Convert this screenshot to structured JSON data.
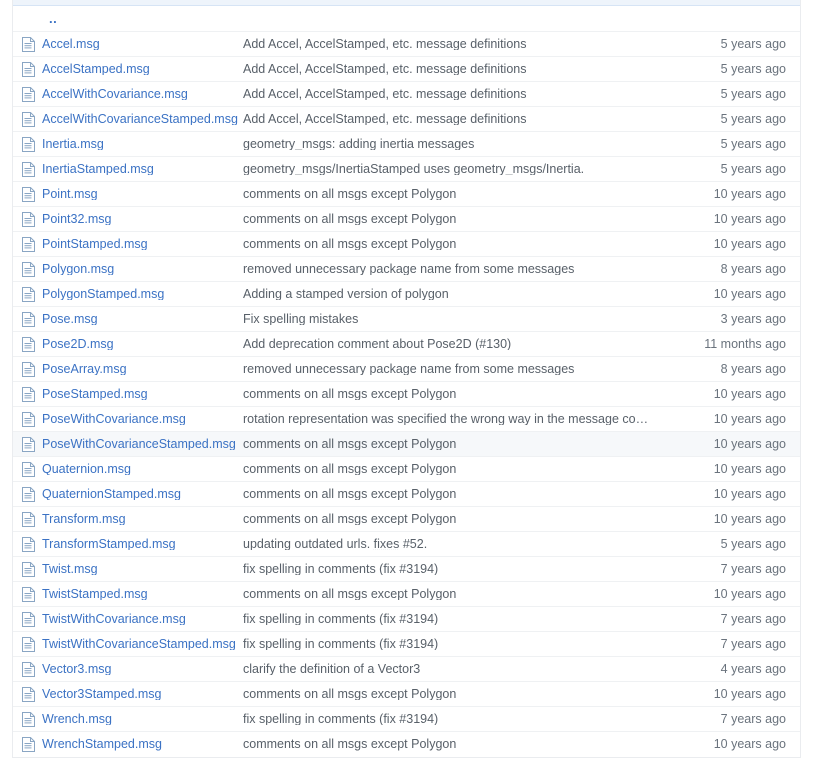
{
  "table": {
    "parent_dir_label": "..",
    "file_icon_name": "file-icon",
    "rows": [
      {
        "name": "Accel.msg",
        "message": "Add Accel, AccelStamped, etc. message definitions",
        "age": "5 years ago",
        "highlight": false
      },
      {
        "name": "AccelStamped.msg",
        "message": "Add Accel, AccelStamped, etc. message definitions",
        "age": "5 years ago",
        "highlight": false
      },
      {
        "name": "AccelWithCovariance.msg",
        "message": "Add Accel, AccelStamped, etc. message definitions",
        "age": "5 years ago",
        "highlight": false
      },
      {
        "name": "AccelWithCovarianceStamped.msg",
        "message": "Add Accel, AccelStamped, etc. message definitions",
        "age": "5 years ago",
        "highlight": false
      },
      {
        "name": "Inertia.msg",
        "message": "geometry_msgs: adding inertia messages",
        "age": "5 years ago",
        "highlight": false
      },
      {
        "name": "InertiaStamped.msg",
        "message": "geometry_msgs/InertiaStamped uses geometry_msgs/Inertia.",
        "age": "5 years ago",
        "highlight": false
      },
      {
        "name": "Point.msg",
        "message": "comments on all msgs except Polygon",
        "age": "10 years ago",
        "highlight": false
      },
      {
        "name": "Point32.msg",
        "message": "comments on all msgs except Polygon",
        "age": "10 years ago",
        "highlight": false
      },
      {
        "name": "PointStamped.msg",
        "message": "comments on all msgs except Polygon",
        "age": "10 years ago",
        "highlight": false
      },
      {
        "name": "Polygon.msg",
        "message": "removed unnecessary package name from some messages",
        "age": "8 years ago",
        "highlight": false
      },
      {
        "name": "PolygonStamped.msg",
        "message": "Adding a stamped version of polygon",
        "age": "10 years ago",
        "highlight": false
      },
      {
        "name": "Pose.msg",
        "message": "Fix spelling mistakes",
        "age": "3 years ago",
        "highlight": false
      },
      {
        "name": "Pose2D.msg",
        "message": "Add deprecation comment about Pose2D (#130)",
        "age": "11 months ago",
        "highlight": false
      },
      {
        "name": "PoseArray.msg",
        "message": "removed unnecessary package name from some messages",
        "age": "8 years ago",
        "highlight": false
      },
      {
        "name": "PoseStamped.msg",
        "message": "comments on all msgs except Polygon",
        "age": "10 years ago",
        "highlight": false
      },
      {
        "name": "PoseWithCovariance.msg",
        "message": "rotation representation was specified the wrong way in the message co…",
        "age": "10 years ago",
        "highlight": false
      },
      {
        "name": "PoseWithCovarianceStamped.msg",
        "message": "comments on all msgs except Polygon",
        "age": "10 years ago",
        "highlight": true
      },
      {
        "name": "Quaternion.msg",
        "message": "comments on all msgs except Polygon",
        "age": "10 years ago",
        "highlight": false
      },
      {
        "name": "QuaternionStamped.msg",
        "message": "comments on all msgs except Polygon",
        "age": "10 years ago",
        "highlight": false
      },
      {
        "name": "Transform.msg",
        "message": "comments on all msgs except Polygon",
        "age": "10 years ago",
        "highlight": false
      },
      {
        "name": "TransformStamped.msg",
        "message": "updating outdated urls. fixes #52.",
        "age": "5 years ago",
        "highlight": false,
        "spellcheck_word": "fixes"
      },
      {
        "name": "Twist.msg",
        "message": "fix spelling in comments (fix #3194)",
        "age": "7 years ago",
        "highlight": false
      },
      {
        "name": "TwistStamped.msg",
        "message": "comments on all msgs except Polygon",
        "age": "10 years ago",
        "highlight": false
      },
      {
        "name": "TwistWithCovariance.msg",
        "message": "fix spelling in comments (fix #3194)",
        "age": "7 years ago",
        "highlight": false
      },
      {
        "name": "TwistWithCovarianceStamped.msg",
        "message": "fix spelling in comments (fix #3194)",
        "age": "7 years ago",
        "highlight": false
      },
      {
        "name": "Vector3.msg",
        "message": "clarify the definition of a Vector3",
        "age": "4 years ago",
        "highlight": false
      },
      {
        "name": "Vector3Stamped.msg",
        "message": "comments on all msgs except Polygon",
        "age": "10 years ago",
        "highlight": false
      },
      {
        "name": "Wrench.msg",
        "message": "fix spelling in comments (fix #3194)",
        "age": "7 years ago",
        "highlight": false
      },
      {
        "name": "WrenchStamped.msg",
        "message": "comments on all msgs except Polygon",
        "age": "10 years ago",
        "highlight": false
      }
    ]
  },
  "colors": {
    "link": "#3b72c4",
    "message_text": "#586069",
    "age_text": "#6a737d",
    "row_border": "#eff1f3",
    "table_border": "#eaecef",
    "header_band": "#eef4fb",
    "highlight_row": "#f6f8fa"
  }
}
